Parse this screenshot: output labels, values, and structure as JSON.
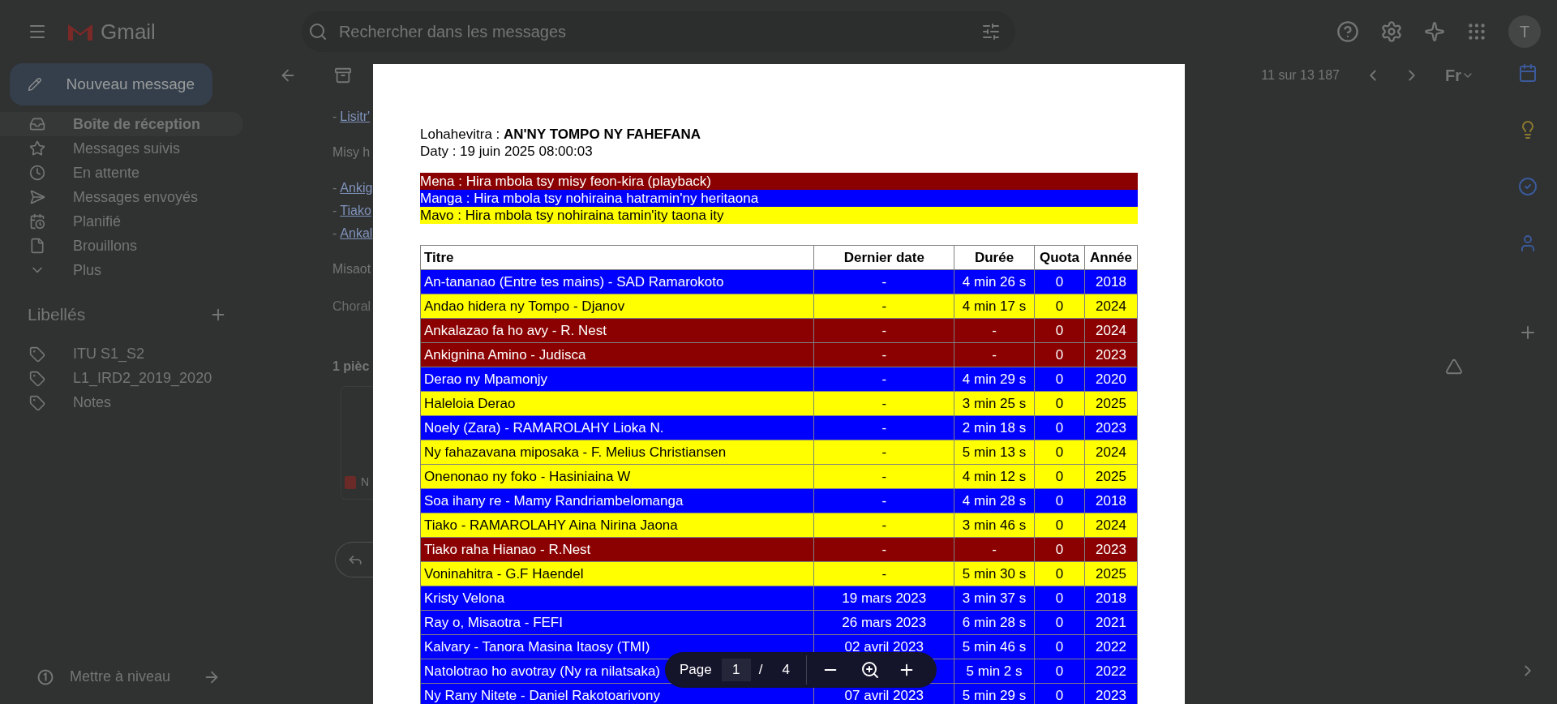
{
  "gmail": {
    "app_name": "Gmail",
    "search": {
      "placeholder": "Rechercher dans les messages"
    },
    "compose": "Nouveau message",
    "nav": [
      {
        "label": "Boîte de réception",
        "selected": true
      },
      {
        "label": "Messages suivis",
        "selected": false
      },
      {
        "label": "En attente",
        "selected": false
      },
      {
        "label": "Messages envoyés",
        "selected": false
      },
      {
        "label": "Planifié",
        "selected": false
      },
      {
        "label": "Brouillons",
        "selected": false
      },
      {
        "label": "Plus",
        "selected": false
      }
    ],
    "labels_title": "Libellés",
    "labels": [
      "ITU S1_S2",
      "L1_IRD2_2019_2020",
      "Notes"
    ],
    "upgrade": "Mettre à niveau",
    "avatar": "T",
    "pager": "11 sur 13 187",
    "input_tool": "Fr",
    "message": [
      {
        "kind": "link",
        "dash": "-",
        "text": "Lisitr'"
      },
      {
        "kind": "text",
        "text": "Misy h"
      },
      {
        "kind": "link",
        "dash": "-",
        "text": "Ankig"
      },
      {
        "kind": "link",
        "dash": "-",
        "text": "Tiako"
      },
      {
        "kind": "link",
        "dash": "-",
        "text": "Ankal"
      },
      {
        "kind": "text",
        "text": "Misaot"
      },
      {
        "kind": "muted",
        "text": "Choral"
      }
    ],
    "attachments_title": "1 pièc",
    "attachment_name": "N"
  },
  "pdf": {
    "subject": "Lohahevitra : **AN'NY TOMPO NY FAHEFANA**",
    "date": "Daty : 19 juin 2025 08:00:03",
    "legend": [
      {
        "text": "Mena : Hira mbola tsy misy feon-kira (playback)",
        "color": "#8b0000"
      },
      {
        "text": "Manga : Hira mbola tsy nohiraina hatramin'ny heritaona",
        "color": "#0000ff"
      },
      {
        "text": "Mavo : Hira mbola tsy nohiraina tamin'ity taona ity",
        "color": "#ffff00"
      }
    ],
    "columns": [
      "Titre",
      "Dernier date",
      "Durée",
      "Quota",
      "Année"
    ],
    "rows": [
      {
        "color": "#0000ff",
        "cells": [
          "An-tananao (Entre tes mains) - SAD Ramarokoto",
          "-",
          "4 min 26 s",
          "0",
          "2018"
        ]
      },
      {
        "color": "#ffff00",
        "cells": [
          "Andao hidera ny Tompo - Djanov",
          "-",
          "4 min 17 s",
          "0",
          "2024"
        ]
      },
      {
        "color": "#8b0000",
        "cells": [
          "Ankalazao fa ho avy - R. Nest",
          "-",
          "-",
          "0",
          "2024"
        ]
      },
      {
        "color": "#8b0000",
        "cells": [
          "Ankignina Amino - Judisca",
          "-",
          "-",
          "0",
          "2023"
        ]
      },
      {
        "color": "#0000ff",
        "cells": [
          "Derao ny Mpamonjy",
          "-",
          "4 min 29 s",
          "0",
          "2020"
        ]
      },
      {
        "color": "#ffff00",
        "cells": [
          "Haleloia Derao",
          "-",
          "3 min 25 s",
          "0",
          "2025"
        ]
      },
      {
        "color": "#0000ff",
        "cells": [
          "Noely (Zara) - RAMAROLAHY Lioka N.",
          "-",
          "2 min 18 s",
          "0",
          "2023"
        ]
      },
      {
        "color": "#ffff00",
        "cells": [
          "Ny fahazavana miposaka - F. Melius Christiansen",
          "-",
          "5 min 13 s",
          "0",
          "2024"
        ]
      },
      {
        "color": "#ffff00",
        "cells": [
          "Onenonao ny foko - Hasiniaina W",
          "-",
          "4 min 12 s",
          "0",
          "2025"
        ]
      },
      {
        "color": "#0000ff",
        "cells": [
          "Soa ihany re - Mamy Randriambelomanga",
          "-",
          "4 min 28 s",
          "0",
          "2018"
        ]
      },
      {
        "color": "#ffff00",
        "cells": [
          "Tiako - RAMAROLAHY Aina Nirina Jaona",
          "-",
          "3 min 46 s",
          "0",
          "2024"
        ]
      },
      {
        "color": "#8b0000",
        "cells": [
          "Tiako raha Hianao - R.Nest",
          "-",
          "-",
          "0",
          "2023"
        ]
      },
      {
        "color": "#ffff00",
        "cells": [
          "Voninahitra - G.F Haendel",
          "-",
          "5 min 30 s",
          "0",
          "2025"
        ]
      },
      {
        "color": "#0000ff",
        "cells": [
          "Kristy Velona",
          "19 mars 2023",
          "3 min 37 s",
          "0",
          "2018"
        ]
      },
      {
        "color": "#0000ff",
        "cells": [
          "Ray o, Misaotra - FEFI",
          "26 mars 2023",
          "6 min 28 s",
          "0",
          "2021"
        ]
      },
      {
        "color": "#0000ff",
        "cells": [
          "Kalvary - Tanora Masina Itaosy (TMI)",
          "02 avril 2023",
          "5 min 46 s",
          "0",
          "2022"
        ]
      },
      {
        "color": "#0000ff",
        "cells": [
          "Natolotrao ho avotray (Ny ra nilatsaka)",
          null,
          "5 min 2 s",
          "0",
          "2022"
        ]
      },
      {
        "color": "#0000ff",
        "cells": [
          "Ny Rany Nitete - Daniel Rakotoarivony",
          "07 avril 2023",
          "5 min 29 s",
          "0",
          "2023"
        ]
      }
    ]
  },
  "viewer_toolbar": {
    "page_label": "Page",
    "page": "1",
    "separator": "/",
    "total": "4"
  }
}
